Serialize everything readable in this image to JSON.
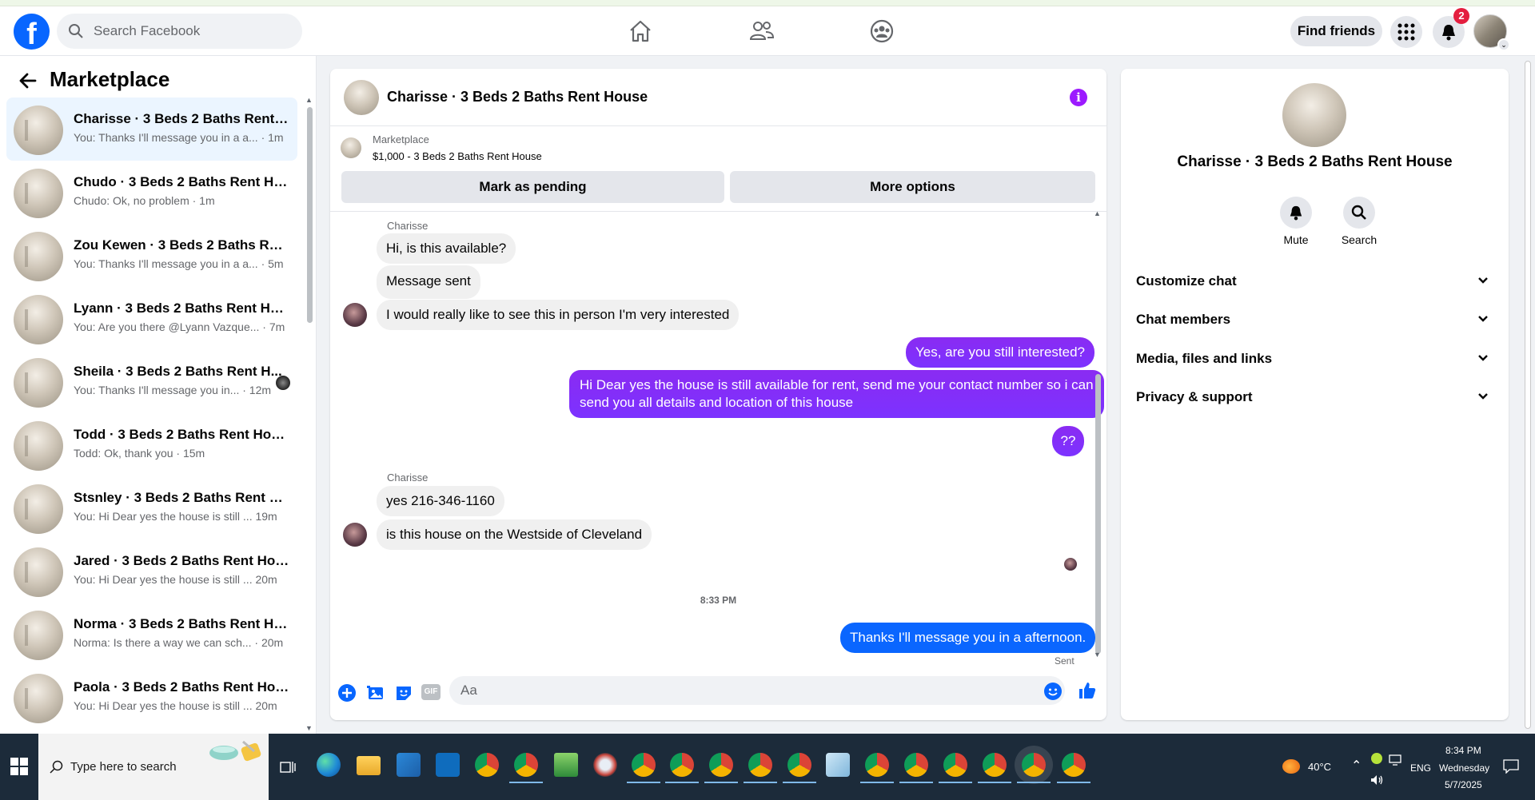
{
  "header": {
    "search_placeholder": "Search Facebook",
    "find_friends": "Find friends",
    "notification_count": "2"
  },
  "sidebar": {
    "title": "Marketplace",
    "conversations": [
      {
        "name": "Charisse · 3 Beds 2 Baths Rent H...",
        "preview": "You: Thanks I'll message you in a a... · 1m",
        "active": true
      },
      {
        "name": "Chudo · 3 Beds 2 Baths Rent Ho...",
        "preview": "Chudo: Ok, no problem · 1m"
      },
      {
        "name": "Zou Kewen · 3 Beds 2 Baths Rent...",
        "preview": "You: Thanks I'll message you in a a... · 5m"
      },
      {
        "name": "Lyann · 3 Beds 2 Baths Rent House",
        "preview": "You: Are you there @Lyann Vazque... · 7m"
      },
      {
        "name": "Sheila · 3 Beds 2 Baths Rent H...",
        "preview": "You: Thanks I'll message you in... · 12m"
      },
      {
        "name": "Todd · 3 Beds 2 Baths Rent House",
        "preview": "Todd: Ok, thank you · 15m"
      },
      {
        "name": "Stsnley · 3 Beds 2 Baths Rent Ho...",
        "preview": "You: Hi Dear yes the house is still ...  19m"
      },
      {
        "name": "Jared · 3 Beds 2 Baths Rent House",
        "preview": "You: Hi Dear yes the house is still ...  20m"
      },
      {
        "name": "Norma · 3 Beds 2 Baths Rent Ho...",
        "preview": "Norma: Is there a way we can sch... · 20m"
      },
      {
        "name": "Paola · 3 Beds 2 Baths Rent House",
        "preview": "You: Hi Dear yes the house is still ...  20m"
      }
    ]
  },
  "chat": {
    "title": "Charisse · 3 Beds 2 Baths Rent House",
    "listing_source": "Marketplace",
    "listing_price_title": "$1,000 - 3 Beds 2 Baths Rent House",
    "mark_pending": "Mark as pending",
    "more_options": "More options",
    "sender_name": "Charisse",
    "messages": {
      "m1": "Hi, is this available?",
      "m2": "Message sent",
      "m3": "I would really like to see this in person I'm very interested",
      "m4": "Yes, are you still interested?",
      "m5_line1": "Hi Dear yes the house is still available for rent, send me your contact number so i can",
      "m5_line2": "send you all details and location of this house",
      "m6": "??",
      "m7": "yes 216-346-1160",
      "m8": "is this house on the Westside of Cleveland",
      "m9": "Thanks I'll message you in a afternoon."
    },
    "time_separator": "8:33 PM",
    "sent_label": "Sent",
    "composer_placeholder": "Aa",
    "gif_label": "GIF"
  },
  "info_panel": {
    "name": "Charisse · 3 Beds 2 Baths Rent House",
    "mute": "Mute",
    "search": "Search",
    "rows": [
      "Customize chat",
      "Chat members",
      "Media, files and links",
      "Privacy & support"
    ]
  },
  "taskbar": {
    "search_placeholder": "Type here to search",
    "weather": "40°C",
    "language": "ENG",
    "time": "8:34 PM",
    "day": "Wednesday",
    "date": "5/7/2025"
  },
  "colors": {
    "fb_blue": "#0866ff",
    "purple_bubble": "#7c32ff",
    "blue_bubble": "#0a66ff",
    "active_conv": "#ebf5ff",
    "taskbar": "#1c2b3a"
  }
}
